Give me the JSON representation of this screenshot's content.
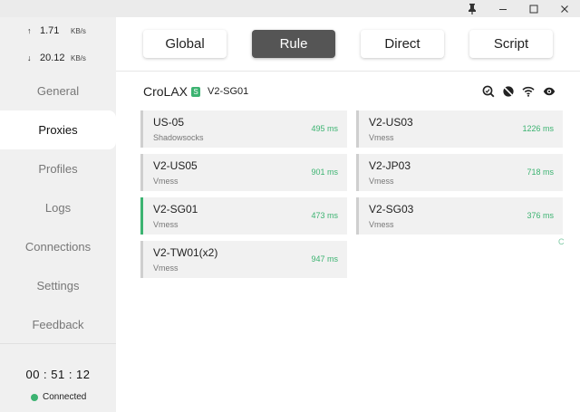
{
  "window_controls": {
    "pin": "📌",
    "minimize": "–",
    "maximize": "☐",
    "close": "✕"
  },
  "traffic": {
    "upload": {
      "arrow": "↑",
      "value": "1.71",
      "unit": "KB/s"
    },
    "download": {
      "arrow": "↓",
      "value": "20.12",
      "unit": "KB/s"
    }
  },
  "nav": [
    "General",
    "Proxies",
    "Profiles",
    "Logs",
    "Connections",
    "Settings",
    "Feedback"
  ],
  "nav_active": "Proxies",
  "timer": "00 : 51 : 12",
  "status": "Connected",
  "modes": [
    "Global",
    "Rule",
    "Direct",
    "Script"
  ],
  "mode_active": "Rule",
  "group": {
    "name": "CroLAX",
    "badge": "S",
    "now": "V2-SG01"
  },
  "proxies": [
    {
      "name": "US-05",
      "type": "Shadowsocks",
      "delay": "495 ms"
    },
    {
      "name": "V2-US03",
      "type": "Vmess",
      "delay": "1226 ms"
    },
    {
      "name": "V2-US05",
      "type": "Vmess",
      "delay": "901 ms"
    },
    {
      "name": "V2-JP03",
      "type": "Vmess",
      "delay": "718 ms"
    },
    {
      "name": "V2-SG01",
      "type": "Vmess",
      "delay": "473 ms",
      "selected": true
    },
    {
      "name": "V2-SG03",
      "type": "Vmess",
      "delay": "376 ms"
    },
    {
      "name": "V2-TW01(x2)",
      "type": "Vmess",
      "delay": "947 ms"
    }
  ],
  "side_mark": "C",
  "colors": {
    "accent": "#3cb371",
    "active_mode": "#555555",
    "sidebar_bg": "#f0f0f0",
    "card_bg": "#f1f1f1"
  }
}
